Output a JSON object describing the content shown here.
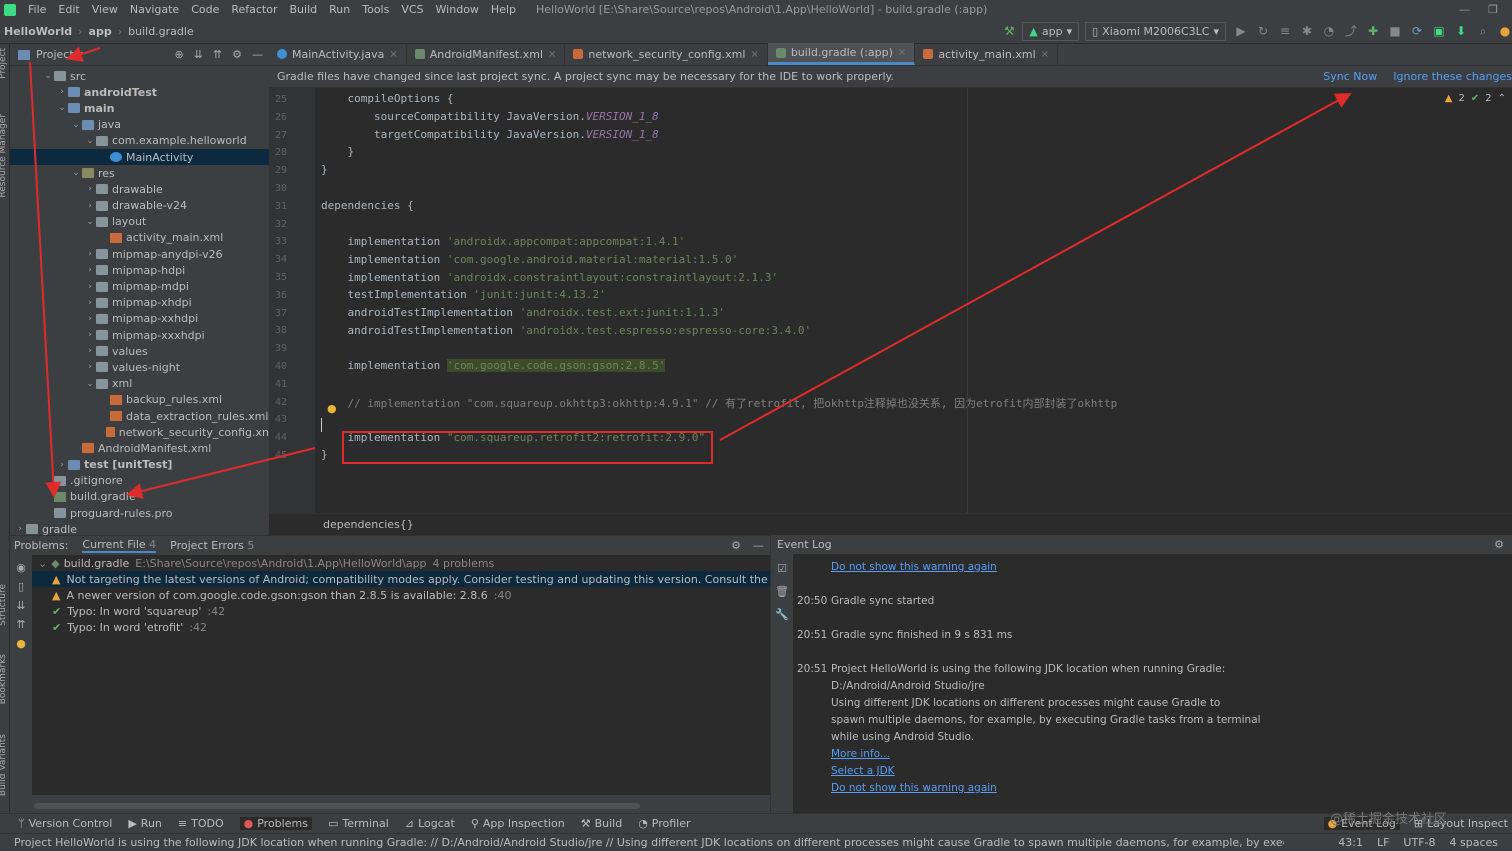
{
  "menubar": {
    "items": [
      "File",
      "Edit",
      "View",
      "Navigate",
      "Code",
      "Refactor",
      "Build",
      "Run",
      "Tools",
      "VCS",
      "Window",
      "Help"
    ],
    "title": "HelloWorld [E:\\Share\\Source\\repos\\Android\\1.App\\HelloWorld] - build.gradle (:app)"
  },
  "navbar": {
    "crumbs": [
      "HelloWorld",
      "app",
      "build.gradle"
    ],
    "run_config": "app",
    "device": "Xiaomi M2006C3LC"
  },
  "project": {
    "title": "Project",
    "tree": [
      {
        "label": "src",
        "depth": 3,
        "arrow": "down",
        "icon": "folder"
      },
      {
        "label": "androidTest",
        "depth": 4,
        "arrow": "right",
        "icon": "folder-src",
        "bold": true
      },
      {
        "label": "main",
        "depth": 4,
        "arrow": "down",
        "icon": "folder-src",
        "bold": true
      },
      {
        "label": "java",
        "depth": 5,
        "arrow": "down",
        "icon": "folder-src"
      },
      {
        "label": "com.example.helloworld",
        "depth": 6,
        "arrow": "down",
        "icon": "folder"
      },
      {
        "label": "MainActivity",
        "depth": 7,
        "arrow": "",
        "icon": "java",
        "selected": true
      },
      {
        "label": "res",
        "depth": 5,
        "arrow": "down",
        "icon": "folder-res"
      },
      {
        "label": "drawable",
        "depth": 6,
        "arrow": "right",
        "icon": "folder"
      },
      {
        "label": "drawable-v24",
        "depth": 6,
        "arrow": "right",
        "icon": "folder"
      },
      {
        "label": "layout",
        "depth": 6,
        "arrow": "down",
        "icon": "folder"
      },
      {
        "label": "activity_main.xml",
        "depth": 7,
        "arrow": "",
        "icon": "xml"
      },
      {
        "label": "mipmap-anydpi-v26",
        "depth": 6,
        "arrow": "right",
        "icon": "folder"
      },
      {
        "label": "mipmap-hdpi",
        "depth": 6,
        "arrow": "right",
        "icon": "folder"
      },
      {
        "label": "mipmap-mdpi",
        "depth": 6,
        "arrow": "right",
        "icon": "folder"
      },
      {
        "label": "mipmap-xhdpi",
        "depth": 6,
        "arrow": "right",
        "icon": "folder"
      },
      {
        "label": "mipmap-xxhdpi",
        "depth": 6,
        "arrow": "right",
        "icon": "folder"
      },
      {
        "label": "mipmap-xxxhdpi",
        "depth": 6,
        "arrow": "right",
        "icon": "folder"
      },
      {
        "label": "values",
        "depth": 6,
        "arrow": "right",
        "icon": "folder"
      },
      {
        "label": "values-night",
        "depth": 6,
        "arrow": "right",
        "icon": "folder"
      },
      {
        "label": "xml",
        "depth": 6,
        "arrow": "down",
        "icon": "folder"
      },
      {
        "label": "backup_rules.xml",
        "depth": 7,
        "arrow": "",
        "icon": "xml"
      },
      {
        "label": "data_extraction_rules.xml",
        "depth": 7,
        "arrow": "",
        "icon": "xml"
      },
      {
        "label": "network_security_config.xn",
        "depth": 7,
        "arrow": "",
        "icon": "xml"
      },
      {
        "label": "AndroidManifest.xml",
        "depth": 5,
        "arrow": "",
        "icon": "manifest"
      },
      {
        "label": "test [unitTest]",
        "depth": 4,
        "arrow": "right",
        "icon": "folder-src",
        "bold": true
      },
      {
        "label": ".gitignore",
        "depth": 3,
        "arrow": "",
        "icon": "file"
      },
      {
        "label": "build.gradle",
        "depth": 3,
        "arrow": "",
        "icon": "gradle"
      },
      {
        "label": "proguard-rules.pro",
        "depth": 3,
        "arrow": "",
        "icon": "file"
      },
      {
        "label": "gradle",
        "depth": 1,
        "arrow": "right",
        "icon": "folder"
      }
    ]
  },
  "editor": {
    "tabs": [
      {
        "label": "MainActivity.java",
        "icon": "java"
      },
      {
        "label": "AndroidManifest.xml",
        "icon": "manifest"
      },
      {
        "label": "network_security_config.xml",
        "icon": "xml"
      },
      {
        "label": "build.gradle (:app)",
        "icon": "gradle",
        "active": true
      },
      {
        "label": "activity_main.xml",
        "icon": "xml"
      }
    ],
    "banner": "Gradle files have changed since last project sync. A project sync may be necessary for the IDE to work properly.",
    "sync_now": "Sync Now",
    "ignore": "Ignore these changes",
    "inspections": {
      "warnings": "2",
      "typos": "2"
    },
    "line_numbers": [
      "25",
      "26",
      "27",
      "28",
      "29",
      "30",
      "31",
      "32",
      "33",
      "34",
      "35",
      "36",
      "37",
      "38",
      "39",
      "40",
      "41",
      "42",
      "43",
      "44",
      "45"
    ],
    "code": {
      "l25": "    compileOptions {",
      "l26a": "        sourceCompatibility JavaVersion.",
      "l26b": "VERSION_1_8",
      "l27a": "        targetCompatibility JavaVersion.",
      "l27b": "VERSION_1_8",
      "l28": "    }",
      "l29": "}",
      "l31": "dependencies {",
      "l33a": "    implementation ",
      "l33b": "'androidx.appcompat:appcompat:1.4.1'",
      "l34a": "    implementation ",
      "l34b": "'com.google.android.material:material:1.5.0'",
      "l35a": "    implementation ",
      "l35b": "'androidx.constraintlayout:constraintlayout:2.1.3'",
      "l36a": "    testImplementation ",
      "l36b": "'junit:junit:4.13.2'",
      "l37a": "    androidTestImplementation ",
      "l37b": "'androidx.test.ext:junit:1.1.3'",
      "l38a": "    androidTestImplementation ",
      "l38b": "'androidx.test.espresso:espresso-core:3.4.0'",
      "l40a": "    implementation ",
      "l40b": "'com.google.code.gson:gson:2.8.5'",
      "l42": "    // implementation \"com.squareup.okhttp3:okhttp:4.9.1\" // 有了retrofit, 把okhttp注释掉也没关系, 因为etrofit内部封装了okhttp",
      "l44a": "    implementation ",
      "l44b": "\"com.squareup.retrofit2:retrofit:2.9.0\"",
      "l45": "}"
    },
    "breadcrumb": "dependencies{}"
  },
  "problems": {
    "label": "Problems:",
    "tabs": [
      {
        "label": "Current File",
        "count": "4",
        "active": true
      },
      {
        "label": "Project Errors",
        "count": "5"
      }
    ],
    "file": "build.gradle",
    "path": "E:\\Share\\Source\\repos\\Android\\1.App\\HelloWorld\\app",
    "summary": "4 problems",
    "items": [
      {
        "type": "warn",
        "text": "Not targeting the latest versions of Android; compatibility modes apply. Consider testing and updating this version. Consult the android.os.Build.VERSIO",
        "line": "",
        "selected": true
      },
      {
        "type": "warn",
        "text": "A newer version of com.google.code.gson:gson than 2.8.5 is available: 2.8.6",
        "line": ":40"
      },
      {
        "type": "ok",
        "text": "Typo: In word 'squareup'",
        "line": ":42"
      },
      {
        "type": "ok",
        "text": "Typo: In word 'etrofit'",
        "line": ":42"
      }
    ]
  },
  "eventlog": {
    "title": "Event Log",
    "entries": [
      {
        "time": "",
        "text": "Do not show this warning again",
        "link": true
      },
      {
        "time": "20:50",
        "text": "Gradle sync started"
      },
      {
        "time": "20:51",
        "text": "Gradle sync finished in 9 s 831 ms"
      },
      {
        "time": "20:51",
        "text": "Project HelloWorld is using the following JDK location when running Gradle:"
      },
      {
        "time": "",
        "text": "D:/Android/Android Studio/jre"
      },
      {
        "time": "",
        "text": "Using different JDK locations on different processes might cause Gradle to"
      },
      {
        "time": "",
        "text": "spawn multiple daemons, for example, by executing Gradle tasks from a terminal"
      },
      {
        "time": "",
        "text": "while using Android Studio."
      },
      {
        "time": "",
        "text": "More info...",
        "link": true
      },
      {
        "time": "",
        "text": "Select a JDK",
        "link": true
      },
      {
        "time": "",
        "text": "Do not show this warning again",
        "link": true
      }
    ]
  },
  "bottom_tools": [
    "Version Control",
    "Run",
    "TODO",
    "Problems",
    "Terminal",
    "Logcat",
    "App Inspection",
    "Build",
    "Profiler"
  ],
  "bottom_right_tools": [
    "Event Log",
    "Layout Inspect"
  ],
  "status": {
    "message": "Project HelloWorld is using the following JDK location when running Gradle: // D:/Android/Android Studio/jre // Using different JDK locations on different processes might cause Gradle to spawn multiple daemons, for example, by executing Gradle tasks fro... (a minute ago)",
    "position": "43:1",
    "line_sep": "LF",
    "encoding": "UTF-8",
    "indent": "4 spaces"
  },
  "side_labels": [
    "Project",
    "Resource Manager",
    "Structure",
    "Bookmarks",
    "Build Variants"
  ],
  "watermark": "@稀土掘金技术社区",
  "colors": {
    "annotation": "#e02b2b",
    "accent": "#4a88c7",
    "link": "#589df6"
  }
}
